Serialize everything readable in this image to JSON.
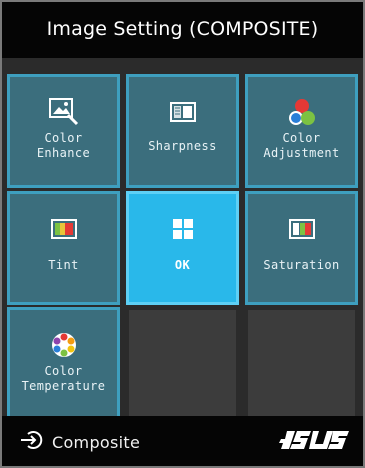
{
  "header": {
    "title": "Image Setting (COMPOSITE)"
  },
  "menu": {
    "tiles": [
      {
        "label": "Color\nEnhance",
        "icon": "image-edit-icon"
      },
      {
        "label": "Sharpness",
        "icon": "sharpness-icon"
      },
      {
        "label": "Color\nAdjustment",
        "icon": "rgb-circles-icon"
      },
      {
        "label": "Tint",
        "icon": "tint-icon"
      },
      {
        "label": "OK",
        "icon": "ok-grid-icon",
        "selected": true
      },
      {
        "label": "Saturation",
        "icon": "saturation-icon"
      },
      {
        "label": "Color\nTemperature",
        "icon": "color-wheel-icon"
      }
    ]
  },
  "footer": {
    "source_label": "Composite",
    "source_icon": "input-source-icon",
    "brand": "ASUS"
  },
  "colors": {
    "tile": "#3b6e7d",
    "tile_border": "#3e9fbf",
    "selected": "#29b8ea",
    "background": "#2d2d2d"
  }
}
